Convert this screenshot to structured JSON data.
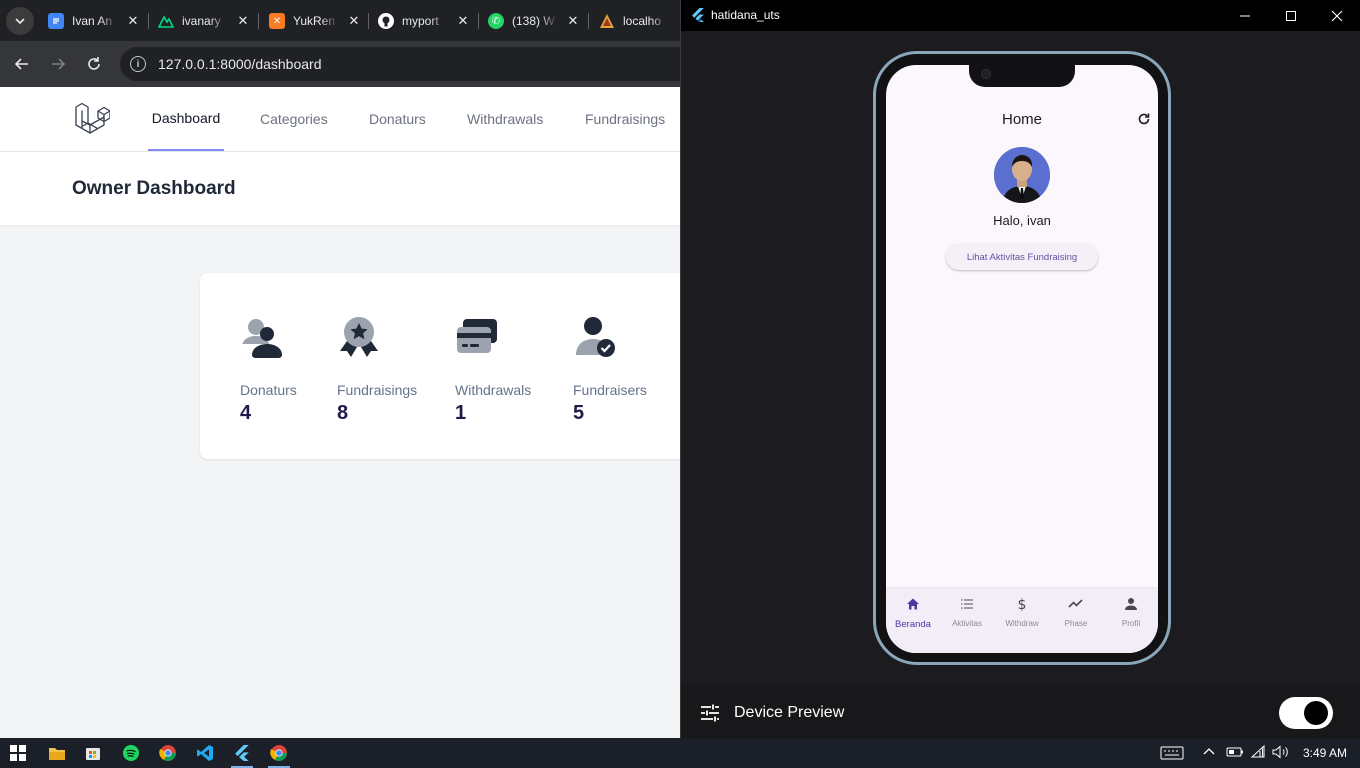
{
  "browser": {
    "tabs": [
      {
        "title": "Ivan An",
        "icon": "google-docs-icon",
        "color": "#4285f4"
      },
      {
        "title": "ivanary",
        "icon": "nuxt-icon",
        "color": "#00dc82"
      },
      {
        "title": "YukRen",
        "icon": "xampp-icon",
        "color": "#fb7a24"
      },
      {
        "title": "myport",
        "icon": "github-icon",
        "color": "#ffffff"
      },
      {
        "title": "(138) W",
        "icon": "whatsapp-icon",
        "color": "#25d366"
      },
      {
        "title": "localho",
        "icon": "xampp-localhost-icon",
        "color": "#e8a33d"
      }
    ],
    "url_host": "127.0.0.1",
    "url_path": ":8000/dashboard"
  },
  "app": {
    "nav": [
      "Dashboard",
      "Categories",
      "Donaturs",
      "Withdrawals",
      "Fundraisings"
    ],
    "active_nav": "Dashboard",
    "page_title": "Owner Dashboard",
    "stats": [
      {
        "label": "Donaturs",
        "value": "4",
        "icon": "users-icon"
      },
      {
        "label": "Fundraisings",
        "value": "8",
        "icon": "award-badge-icon"
      },
      {
        "label": "Withdrawals",
        "value": "1",
        "icon": "credit-card-icon"
      },
      {
        "label": "Fundraisers",
        "value": "5",
        "icon": "user-check-icon"
      }
    ],
    "accent": "#818cf8"
  },
  "flutter": {
    "window_title": "hatidana_uts",
    "appbar_title": "Home",
    "greeting": "Halo, ivan",
    "action_button": "Lihat Aktivitas Fundraising",
    "bottom_nav": [
      {
        "label": "Beranda",
        "icon": "home-icon"
      },
      {
        "label": "Aktivitas",
        "icon": "list-icon"
      },
      {
        "label": "Withdraw",
        "icon": "dollar-icon"
      },
      {
        "label": "Phase",
        "icon": "trending-icon"
      },
      {
        "label": "Profil",
        "icon": "person-icon"
      }
    ],
    "device_preview_label": "Device Preview",
    "device_preview_enabled": true,
    "primary": "#6750a4"
  },
  "taskbar": {
    "time": "3:49 AM"
  }
}
